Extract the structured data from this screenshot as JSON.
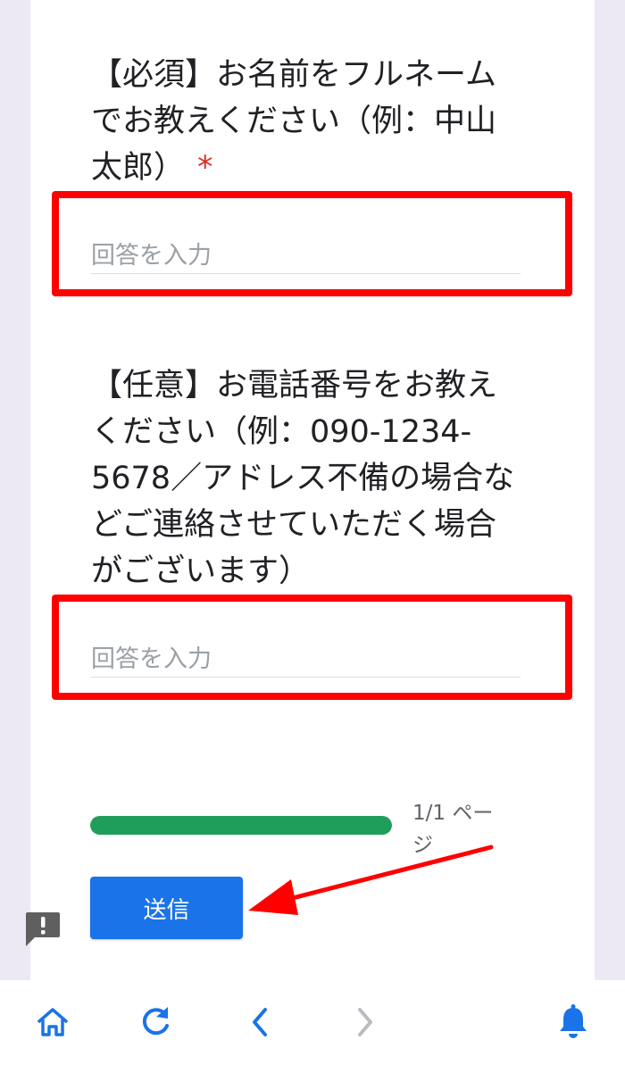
{
  "form": {
    "question1": {
      "text": "【必須】お名前をフルネームでお教えください（例：中山太郎）",
      "required_mark": "*",
      "placeholder": "回答を入力"
    },
    "question2": {
      "text": "【任意】お電話番号をお教えください（例：090-1234-5678／アドレス不備の場合などご連絡させていただく場合がございます）",
      "placeholder": "回答を入力"
    },
    "progress": {
      "fraction": 1.0,
      "label": "1/1 ページ"
    },
    "submit_label": "送信"
  },
  "colors": {
    "accent_blue": "#1a73e8",
    "progress_green": "#1e9e5a",
    "highlight_red": "#ff0000",
    "required_red": "#d93025",
    "page_background": "#ece8f4",
    "nav_icon_blue": "#1a73e8"
  },
  "icons": {
    "report": "report-problem-icon",
    "nav": [
      "home-icon",
      "reload-icon",
      "back-arrow-icon",
      "forward-arrow-icon",
      "notifications-bell-icon"
    ]
  }
}
